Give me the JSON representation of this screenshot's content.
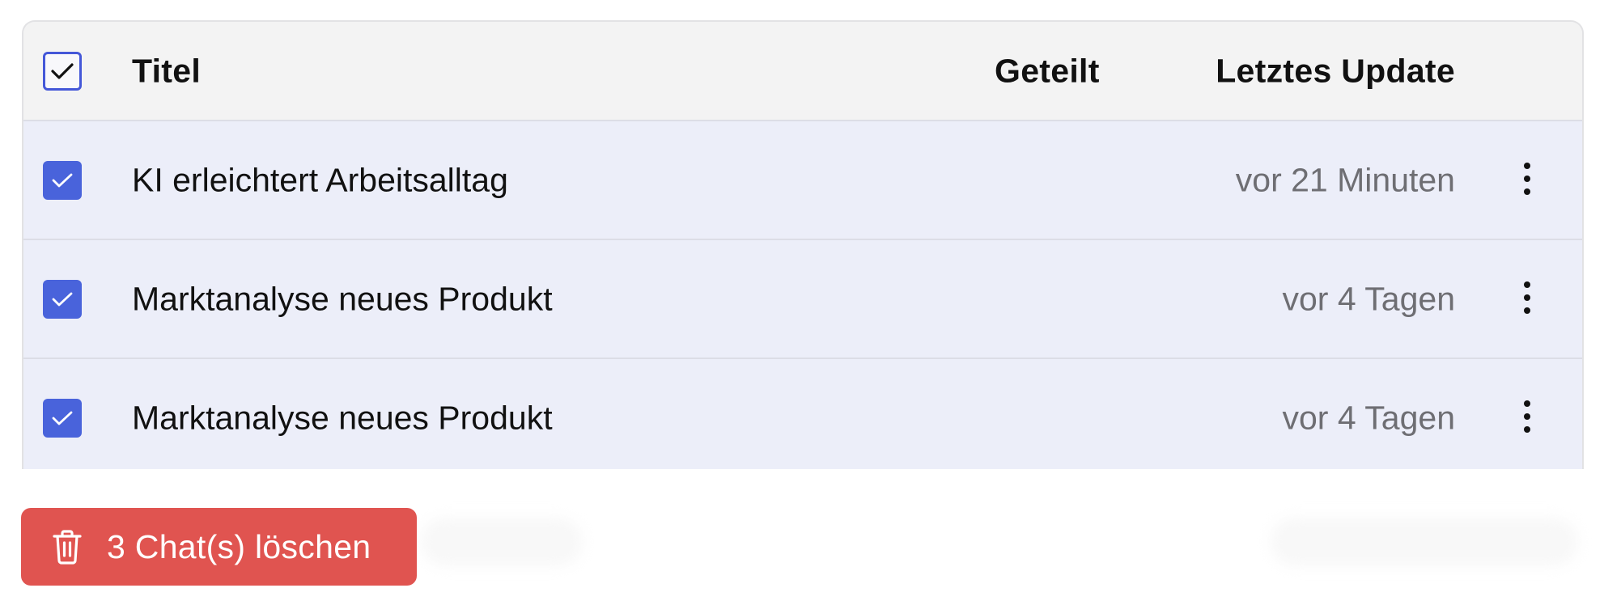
{
  "table": {
    "columns": {
      "title": "Titel",
      "shared": "Geteilt",
      "updated": "Letztes Update"
    },
    "select_all_checked": true,
    "rows": [
      {
        "title": "KI erleichtert Arbeitsalltag",
        "shared": "",
        "updated": "vor 21 Minuten",
        "checked": true,
        "menu_icon": "more-vertical-icon"
      },
      {
        "title": "Marktanalyse neues Produkt",
        "shared": "",
        "updated": "vor 4 Tagen",
        "checked": true,
        "menu_icon": "more-vertical-icon"
      },
      {
        "title": "Marktanalyse neues Produkt",
        "shared": "",
        "updated": "vor 4 Tagen",
        "checked": true,
        "menu_icon": "more-vertical-icon"
      }
    ]
  },
  "actions": {
    "delete_label": "3 Chat(s) löschen",
    "delete_icon": "trash-icon"
  },
  "colors": {
    "accent": "#4963db",
    "danger": "#e05450",
    "row_selected": "#eceef9",
    "header_bg": "#f3f3f3",
    "muted_text": "#6e6e73"
  }
}
